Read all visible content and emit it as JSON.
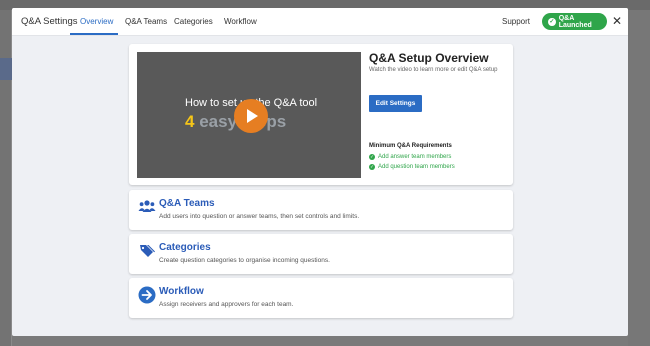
{
  "header": {
    "title": "Q&A Settings",
    "tabs": [
      {
        "label": "Overview",
        "active": true
      },
      {
        "label": "Q&A Teams",
        "active": false
      },
      {
        "label": "Categories",
        "active": false
      },
      {
        "label": "Workflow",
        "active": false
      }
    ],
    "support_label": "Support",
    "status_badge": "Q&A Launched",
    "close_icon": "close-icon"
  },
  "overview": {
    "video": {
      "line1": "How to set up the Q&A tool",
      "line2_number": "4",
      "line2_text": "easy steps",
      "play_icon": "play-icon"
    },
    "title": "Q&A Setup Overview",
    "subtitle": "Watch the video to learn more or edit Q&A setup",
    "edit_button": "Edit Settings",
    "requirements_title": "Minimum Q&A Requirements",
    "requirements": [
      "Add answer team members",
      "Add question team members"
    ]
  },
  "features": [
    {
      "title": "Q&A Teams",
      "description": "Add users into question or answer teams, then set controls and limits.",
      "icon": "people-icon"
    },
    {
      "title": "Categories",
      "description": "Create question categories to organise incoming questions.",
      "icon": "tags-icon"
    },
    {
      "title": "Workflow",
      "description": "Assign receivers and approvers for each team.",
      "icon": "arrow-right-circle-icon"
    }
  ],
  "colors": {
    "accent": "#2b6cc4",
    "success": "#2fa54a",
    "play_button": "#e67e22"
  }
}
